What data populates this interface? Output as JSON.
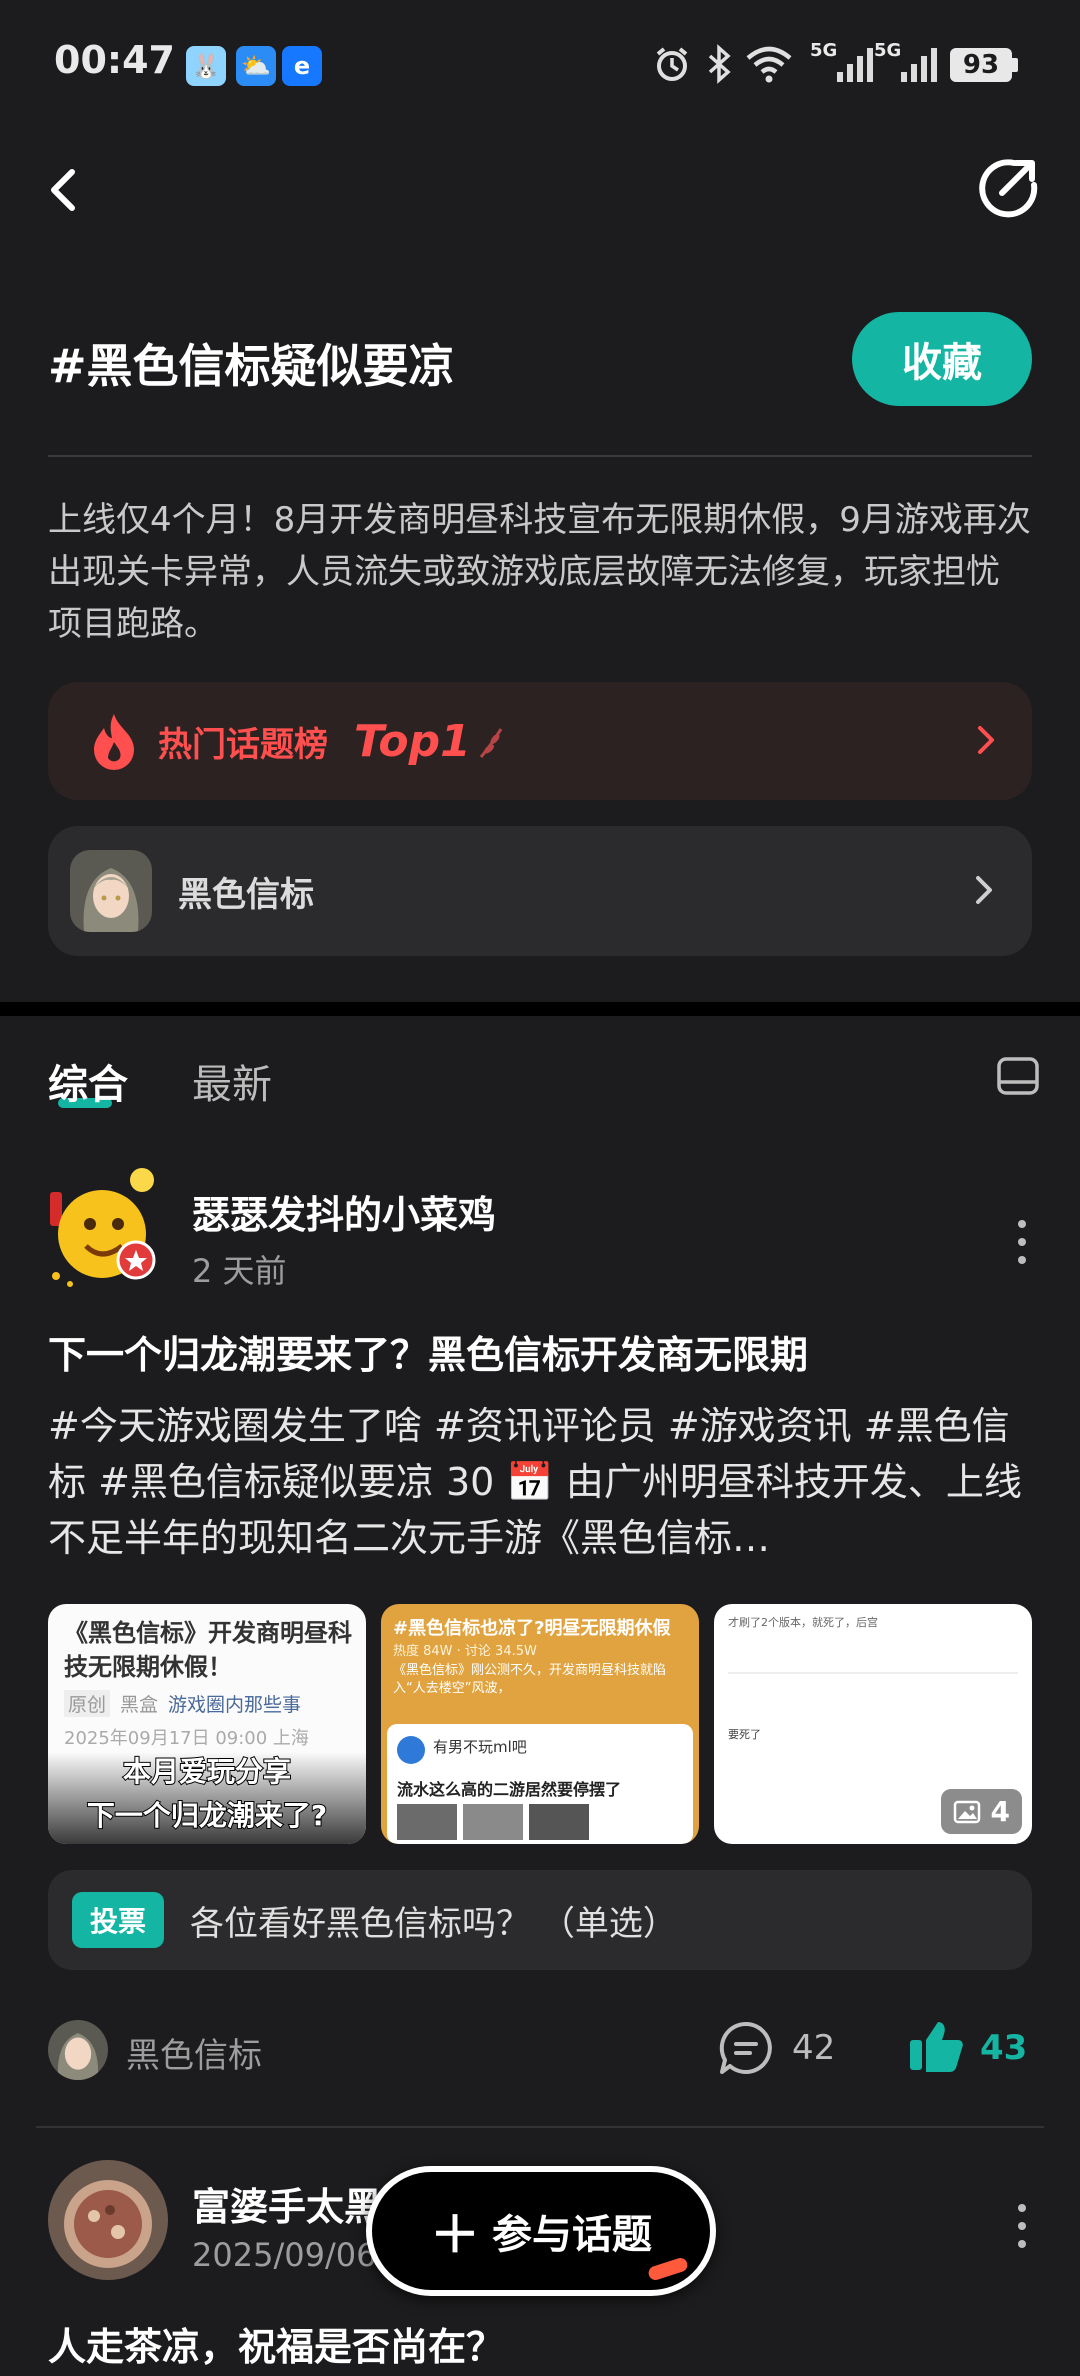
{
  "status_bar": {
    "time": "00:47",
    "net1": "5G",
    "net2": "5G",
    "battery": "93"
  },
  "header": {
    "title": "#黑色信标疑似要凉",
    "collect_label": "收藏",
    "description": "上线仅4个月！8月开发商明昼科技宣布无限期休假，9月游戏再次出现关卡异常，人员流失或致游戏底层故障无法修复，玩家担忧项目跑路。"
  },
  "hot_card": {
    "label": "热门话题榜",
    "rank": "Top1"
  },
  "game_card": {
    "name": "黑色信标"
  },
  "tabs": [
    {
      "label": "综合"
    },
    {
      "label": "最新"
    }
  ],
  "post1": {
    "author": "瑟瑟发抖的小菜鸡",
    "time": "2 天前",
    "title": "下一个归龙潮要来了？黑色信标开发商无限期",
    "body": "#今天游戏圈发生了啥 #资讯评论员 #游戏资讯 #黑色信标 #黑色信标疑似要凉 30 📅 由广州明昼科技开发、上线不足半年的现知名二次元手游《黑色信标…",
    "thumb1": {
      "headline": "《黑色信标》开发商明昼科技无限期休假！",
      "tag_orig": "原创",
      "tag_src": "黑盒",
      "channel": "游戏圈内那些事",
      "datetime": "2025年09月17日 09:00 上海",
      "overlay_line1": "本月爱玩分享",
      "overlay_line2": "下一个归龙潮来了?"
    },
    "thumb2": {
      "headline": "#黑色信标也凉了?明昼无限期休假",
      "stats": "热度 84W · 讨论 34.5W",
      "snippet": "《黑色信标》刚公测不久，开发商明昼科技就陷入“人去楼空”风波，",
      "user": "有男不玩ml吧",
      "post_title": "流水这么高的二游居然要停摆了"
    },
    "thumb3": {
      "top_text": "才刷了2个版本，就死了，后宫",
      "reply": "要死了",
      "count": "4"
    },
    "vote": {
      "badge": "投票",
      "question": "各位看好黑色信标吗？ （单选）"
    },
    "footer": {
      "topic": "黑色信标",
      "comments": "42",
      "likes": "43"
    }
  },
  "post2": {
    "author": "富婆手太黑",
    "time": "2025/09/06",
    "title": "人走茶凉，祝福是否尚在？"
  },
  "fab": {
    "label": "参与话题"
  },
  "colors": {
    "accent": "#14b5a3",
    "hot": "#ff4f4f",
    "background": "#1c1c1e"
  }
}
